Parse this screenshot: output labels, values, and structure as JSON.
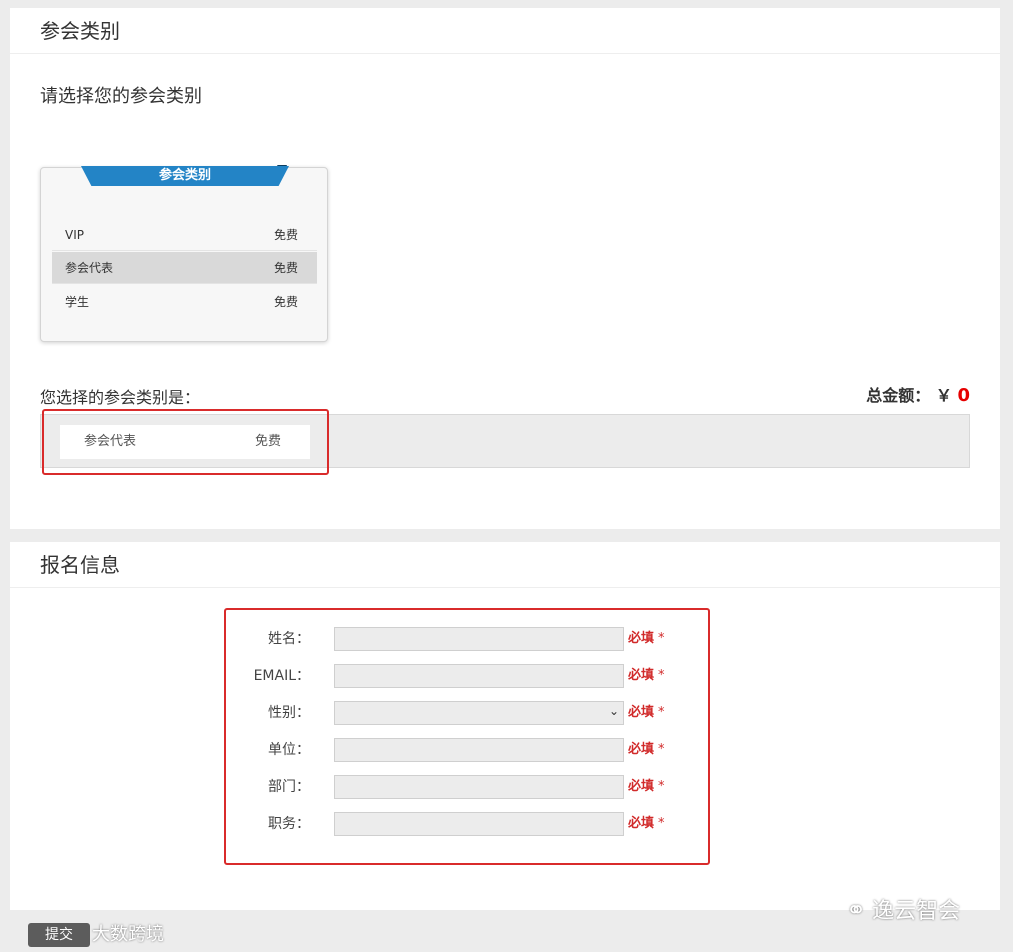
{
  "category_panel": {
    "title": "参会类别",
    "prompt": "请选择您的参会类别",
    "card_title": "参会类别",
    "options": [
      {
        "name": "VIP",
        "price": "免费",
        "selected": false
      },
      {
        "name": "参会代表",
        "price": "免费",
        "selected": true
      },
      {
        "name": "学生",
        "price": "免费",
        "selected": false
      }
    ],
    "chosen_label": "您选择的参会类别是：",
    "total_label": "总金额：",
    "currency": "￥",
    "total_amount": "0",
    "chosen": {
      "name": "参会代表",
      "price": "免费"
    }
  },
  "register_panel": {
    "title": "报名信息",
    "fields": [
      {
        "label": "姓名：",
        "type": "text",
        "required": "必填",
        "star": "*"
      },
      {
        "label": "EMAIL：",
        "type": "text",
        "required": "必填",
        "star": "*"
      },
      {
        "label": "性别：",
        "type": "select",
        "required": "必填",
        "star": "*"
      },
      {
        "label": "单位：",
        "type": "text",
        "required": "必填",
        "star": "*"
      },
      {
        "label": "部门：",
        "type": "text",
        "required": "必填",
        "star": "*"
      },
      {
        "label": "职务：",
        "type": "text",
        "required": "必填",
        "star": "*"
      }
    ]
  },
  "submit_label": "提交",
  "watermark_right": "逸云智会",
  "watermark_left": "大数跨境",
  "colors": {
    "accent": "#2384c6",
    "required": "#d12a2a",
    "highlight": "#d92b2b"
  }
}
